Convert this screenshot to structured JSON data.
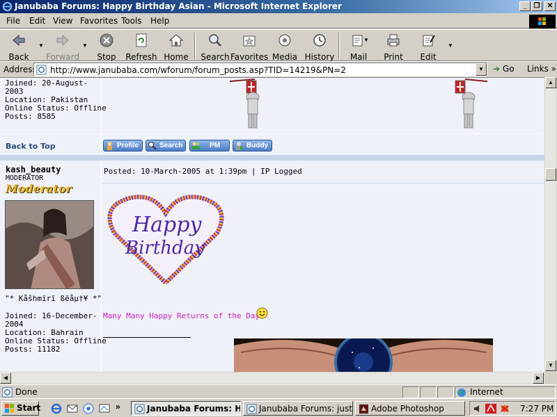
{
  "window": {
    "title": "Janubaba Forums: Happy Birthday Asian - Microsoft Internet Explorer",
    "minimize": "_",
    "maximize": "❐",
    "close": "✕"
  },
  "menu": [
    "File",
    "Edit",
    "View",
    "Favorites",
    "Tools",
    "Help"
  ],
  "toolbar": {
    "back": "Back",
    "forward": "Forward",
    "stop": "Stop",
    "refresh": "Refresh",
    "home": "Home",
    "search": "Search",
    "favorites": "Favorites",
    "media": "Media",
    "history": "History",
    "mail": "Mail",
    "print": "Print",
    "edit": "Edit"
  },
  "address": {
    "label": "Address",
    "url": "http://www.janubaba.com/wforum/forum_posts.asp?TID=14219&PN=2",
    "go": "Go",
    "links": "Links"
  },
  "prev_post": {
    "joined": "Joined: 20-August-",
    "joined_year": "2003",
    "location": "Location: Pakistan",
    "status": "Online Status: Offline",
    "posts": "Posts: 8585",
    "back_to_top": "Back to Top",
    "buttons": {
      "profile": "Profile",
      "search": "Search",
      "pm": "PM",
      "buddy": "Buddy"
    }
  },
  "post": {
    "username": "kash_beauty",
    "role": "MODERATOR",
    "badge": "Moderator",
    "tagline": "\"* Kåšhmïrï ßëåµ†¥ *\"",
    "joined": "Joined: 16-December-",
    "joined_year": "2004",
    "location": "Location: Bahrain",
    "status": "Online Status: Offline",
    "posts": "Posts: 11182",
    "posted": "Posted: 10-March-2005 at 1:39pm | IP Logged",
    "card_line1": "Happy",
    "card_line2": "Birthday",
    "message": "Many Many Happy Returns of the Day"
  },
  "status": {
    "text": "Done",
    "zone": "Internet"
  },
  "taskbar": {
    "start": "Start",
    "quicklaunch_more": "»",
    "tasks": [
      "Janubaba Forums: H...",
      "Janubaba Forums: just wo...",
      "Adobe Photoshop"
    ],
    "clock": "7:27 PM"
  }
}
